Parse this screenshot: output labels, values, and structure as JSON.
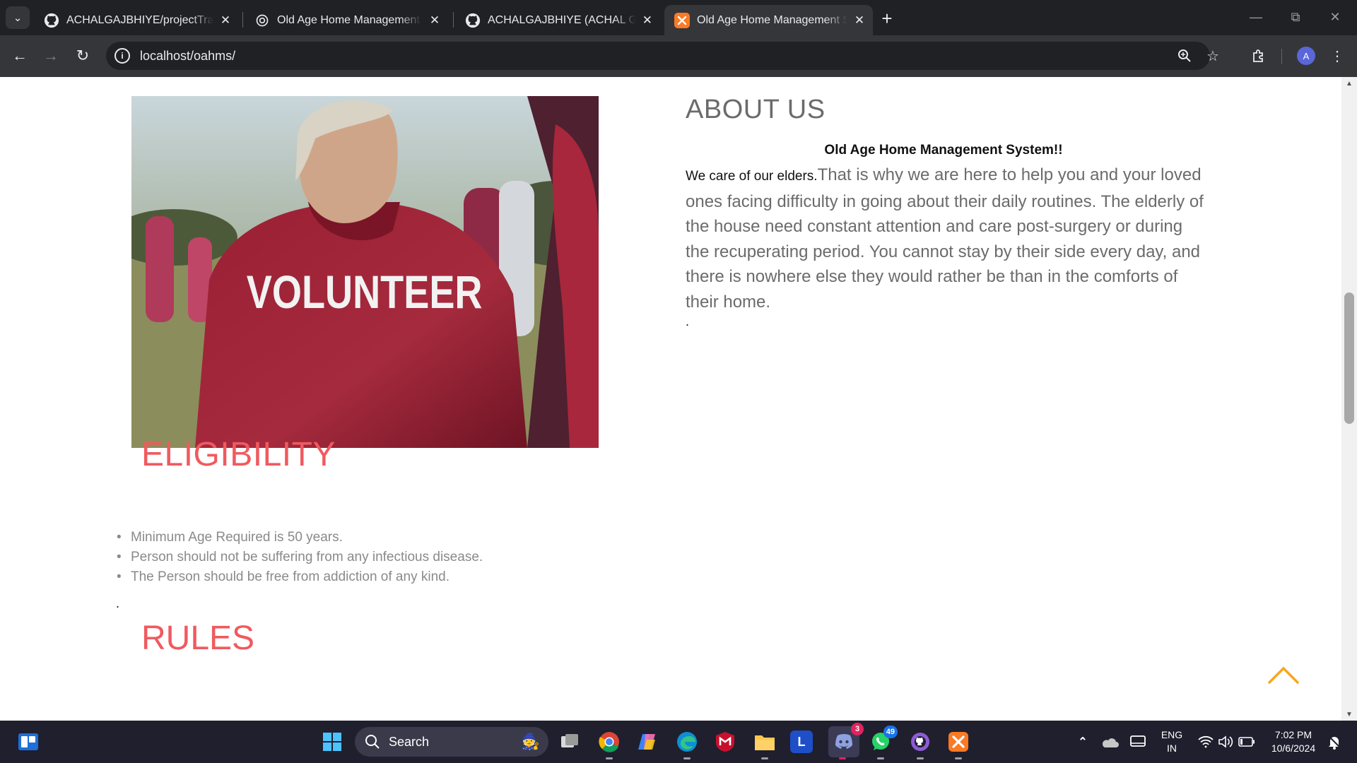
{
  "browser": {
    "tabs": [
      {
        "title": "ACHALGAJBHIYE/projectTravelling",
        "icon": "github-icon"
      },
      {
        "title": "Old Age Home Management",
        "icon": "chatgpt-icon"
      },
      {
        "title": "ACHALGAJBHIYE (ACHAL GAJBHIYE)",
        "icon": "github-icon"
      },
      {
        "title": "Old Age Home Management System",
        "icon": "xampp-icon",
        "active": true
      }
    ],
    "url": "localhost/oahms/",
    "profile_initial": "A"
  },
  "about": {
    "title": "ABOUT US",
    "subtitle": "Old Age Home Management System!!",
    "lead": "We care of our elders.",
    "body": "That is why we are here to help you and your loved ones facing difficulty in going about their daily routines. The elderly of the house need constant attention and care post-surgery or during the recuperating period. You cannot stay by their side every day, and there is nowhere else they would rather be than in the comforts of their home.",
    "trailing_dot": ".",
    "image_text": "VOLUNTEER"
  },
  "eligibility": {
    "title": "ELIGIBILITY",
    "items": [
      "Minimum Age Required is 50 years.",
      "Person should not be suffering from any infectious disease.",
      "The Person should be free from addiction of any kind."
    ],
    "trailing_dot": "."
  },
  "rules": {
    "title": "RULES"
  },
  "taskbar": {
    "search_label": "Search",
    "discord_badge": "3",
    "whatsapp_badge": "49",
    "language": "ENG",
    "region": "IN",
    "time": "7:02 PM",
    "date": "10/6/2024"
  },
  "colors": {
    "accent_red": "#f05a5f",
    "scroll_arrow": "#f5a623",
    "chrome_dark": "#202124",
    "chrome_toolbar": "#35363a"
  }
}
